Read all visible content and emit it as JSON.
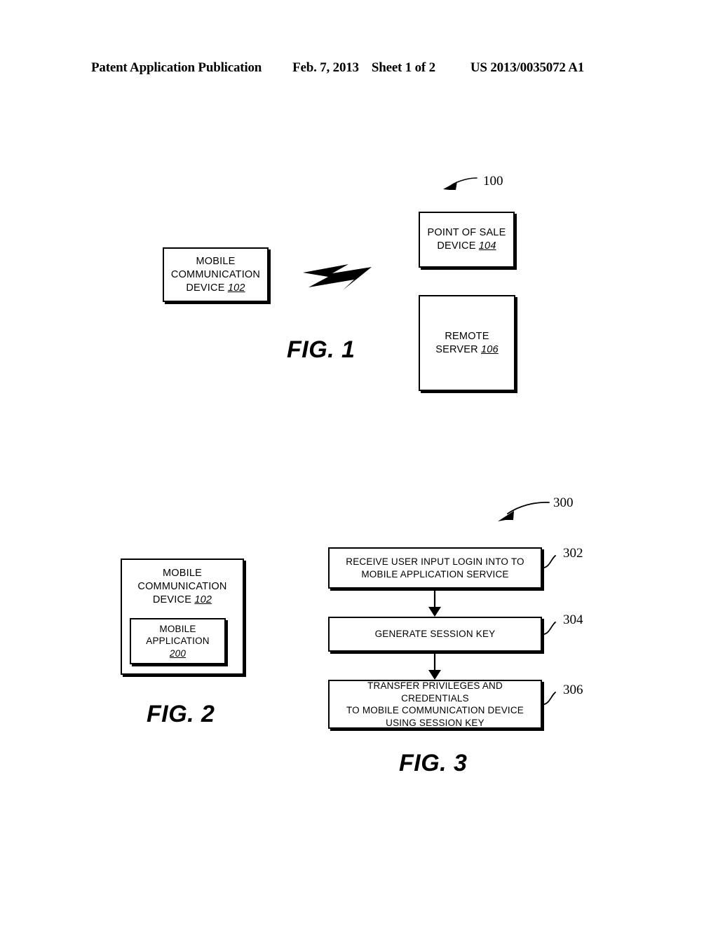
{
  "header": {
    "publication": "Patent Application Publication",
    "date": "Feb. 7, 2013",
    "sheet": "Sheet 1 of 2",
    "doc_number": "US 2013/0035072 A1"
  },
  "figures": [
    {
      "id": "fig1",
      "caption": "FIG. 1",
      "system_label": "100",
      "boxes": [
        {
          "name": "mobile-communication-device",
          "lines": [
            "MOBILE",
            "COMMUNICATION",
            "DEVICE "
          ],
          "ref": "102"
        },
        {
          "name": "point-of-sale-device",
          "lines": [
            "POINT OF SALE",
            "DEVICE "
          ],
          "ref": "104"
        },
        {
          "name": "remote-server",
          "lines": [
            "REMOTE",
            "SERVER "
          ],
          "ref": "106"
        }
      ],
      "link_symbol": "wireless-lightning-bolt"
    },
    {
      "id": "fig2",
      "caption": "FIG. 2",
      "boxes": [
        {
          "name": "mobile-communication-device",
          "lines": [
            "MOBILE",
            "COMMUNICATION",
            "DEVICE "
          ],
          "ref": "102"
        },
        {
          "name": "mobile-application",
          "lines": [
            "MOBILE",
            "APPLICATION",
            ""
          ],
          "ref": "200"
        }
      ]
    },
    {
      "id": "fig3",
      "caption": "FIG. 3",
      "system_label": "300",
      "steps": [
        {
          "name": "step-receive-user-input-login",
          "lines": [
            "RECEIVE USER INPUT LOGIN INTO TO",
            "MOBILE APPLICATION SERVICE"
          ],
          "ref": "302"
        },
        {
          "name": "step-generate-session-key",
          "lines": [
            "GENERATE SESSION KEY"
          ],
          "ref": "304"
        },
        {
          "name": "step-transfer-privileges",
          "lines": [
            "TRANSFER PRIVILEGES AND CREDENTIALS",
            "TO MOBILE COMMUNICATION DEVICE",
            "USING SESSION KEY"
          ],
          "ref": "306"
        }
      ]
    }
  ],
  "colors": {
    "ink": "#000000",
    "paper": "#ffffff"
  }
}
